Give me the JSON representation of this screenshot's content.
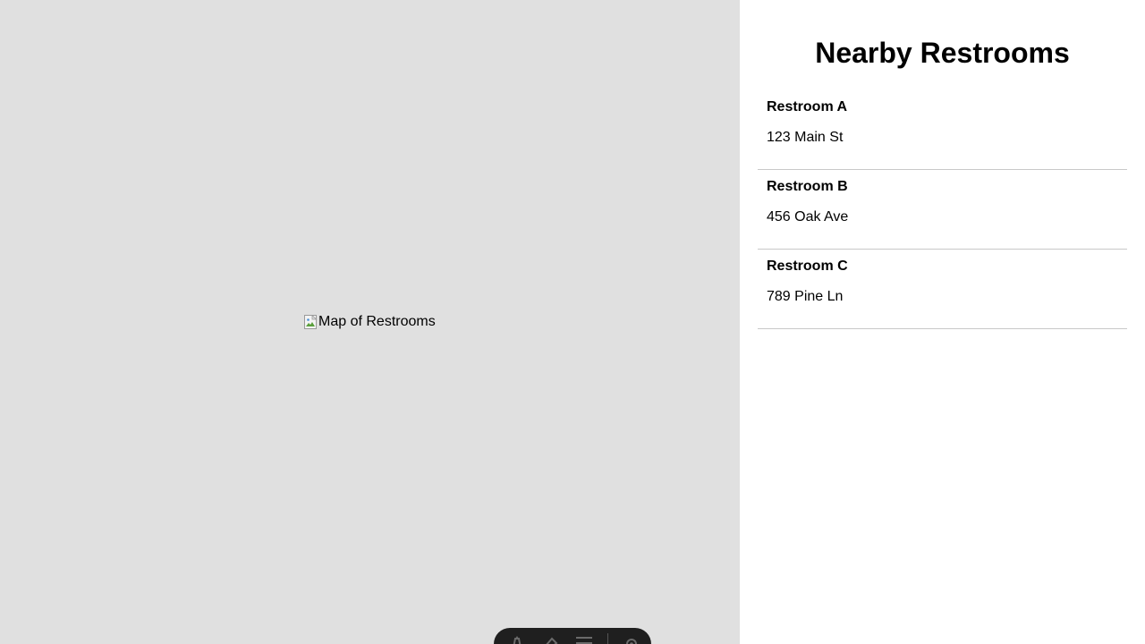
{
  "map": {
    "image_alt": "Map of Restrooms",
    "toolbar": {
      "icons": [
        "pen-icon",
        "eraser-icon",
        "menu-icon",
        "settings-icon"
      ]
    }
  },
  "sidebar": {
    "title": "Nearby Restrooms",
    "restrooms": [
      {
        "name": "Restroom A",
        "address": "123 Main St"
      },
      {
        "name": "Restroom B",
        "address": "456 Oak Ave"
      },
      {
        "name": "Restroom C",
        "address": "789 Pine Ln"
      }
    ]
  },
  "colors": {
    "map_background": "#e0e0e0",
    "sidebar_background": "#ffffff",
    "divider": "#c8c8c8",
    "toolbar_background": "#1f1f1f"
  }
}
